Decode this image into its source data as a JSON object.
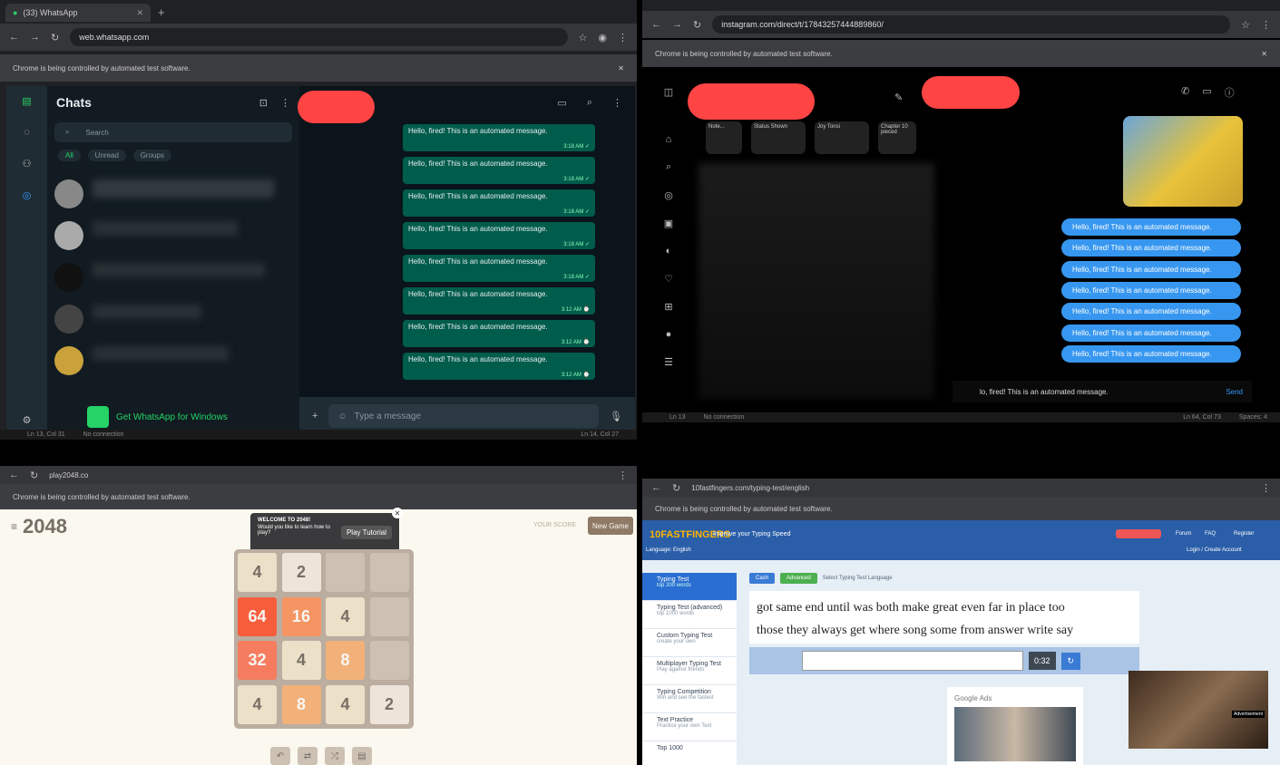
{
  "whatsapp": {
    "tab_title": "(33) WhatsApp",
    "url": "web.whatsapp.com",
    "automation_notice": "Chrome is being controlled by automated test software.",
    "chats_title": "Chats",
    "search_placeholder": "Search",
    "filters": [
      "All",
      "Unread",
      "Groups"
    ],
    "messages": [
      {
        "text": "Hello, fired! This is an automated message.",
        "time": "3:18 AM ✓"
      },
      {
        "text": "Hello, fired! This is an automated message.",
        "time": "3:18 AM ✓"
      },
      {
        "text": "Hello, fired! This is an automated message.",
        "time": "3:18 AM ✓"
      },
      {
        "text": "Hello, fired! This is an automated message.",
        "time": "3:18 AM ✓"
      },
      {
        "text": "Hello, fired! This is an automated message.",
        "time": "3:18 AM ✓"
      },
      {
        "text": "Hello, fired! This is an automated message.",
        "time": "3:12 AM ⌚"
      },
      {
        "text": "Hello, fired! This is an automated message.",
        "time": "3:12 AM ⌚"
      },
      {
        "text": "Hello, fired! This is an automated message.",
        "time": "3:12 AM ⌚"
      }
    ],
    "message_placeholder": "Type a message",
    "get_app": "Get WhatsApp for Windows",
    "status_left": "Ln 13, Col 31",
    "status_mid": "No connection",
    "status_right": "Ln 14, Col 27"
  },
  "instagram": {
    "url": "instagram.com/direct/t/17843257444889860/",
    "automation_notice": "Chrome is being controlled by automated test software.",
    "stories": [
      "Note...",
      "Status Shown",
      "Joy Tonsi",
      "Chapter 10 pieced"
    ],
    "messages": [
      "Hello, fired! This is an automated message.",
      "Hello, fired! This is an automated message.",
      "Hello, fired! This is an automated message.",
      "Hello, fired! This is an automated message.",
      "Hello, fired! This is an automated message.",
      "Hello, fired! This is an automated message.",
      "Hello, fired! This is an automated message."
    ],
    "composer_text": "lo, fired! This is an automated message.",
    "send_label": "Send",
    "status_left": "Ln 13",
    "status_mid": "No connection",
    "status_right": "Ln 64, Col 73",
    "status_spaces": "Spaces: 4"
  },
  "game2048": {
    "url": "play2048.co",
    "automation_notice": "Chrome is being controlled by automated test software.",
    "title": "2048",
    "popup_title": "WELCOME TO 2048!",
    "popup_text": "Would you like to learn how to play?",
    "popup_button": "Play Tutorial",
    "new_game": "New Game",
    "score_label": "YOUR SCORE",
    "grid": [
      [
        4,
        2,
        0,
        0
      ],
      [
        64,
        16,
        4,
        0
      ],
      [
        32,
        4,
        8,
        0
      ],
      [
        4,
        8,
        4,
        2
      ]
    ]
  },
  "typing": {
    "url": "10fastfingers.com/typing-test/english",
    "automation_notice": "Chrome is being controlled by automated test software.",
    "brand": "10FASTFINGERS",
    "tagline": "Improve your Typing Speed",
    "language": "Language: English",
    "nav": [
      "Forum",
      "FAQ",
      "Register"
    ],
    "login": "Login / Create Account",
    "sidebar": [
      {
        "title": "Typing Test",
        "sub": "top 200 words"
      },
      {
        "title": "Typing Test (advanced)",
        "sub": "top 1000 words"
      },
      {
        "title": "Custom Typing Test",
        "sub": "create your own"
      },
      {
        "title": "Multiplayer Typing Test",
        "sub": "Play against friends"
      },
      {
        "title": "Typing Competition",
        "sub": "Win and see the fastest"
      },
      {
        "title": "Text Practice",
        "sub": "Practice your own Text"
      },
      {
        "title": "Top 1000",
        "sub": ""
      }
    ],
    "mode_tabs": [
      "Cash",
      "Advanced"
    ],
    "mode_hint": "Select Typing Test Language",
    "words_line1": "got same end until was both make great even far in place too",
    "words_line2": "those they always get where song some from answer write say",
    "timer": "0:32",
    "ads_label": "Google Ads",
    "promo": "Advertisement"
  },
  "colors": {
    "wa_green": "#005c4b",
    "ig_blue": "#3797f0",
    "redaction": "#ff4444",
    "tile_2048_orange": "#f65e3b"
  }
}
